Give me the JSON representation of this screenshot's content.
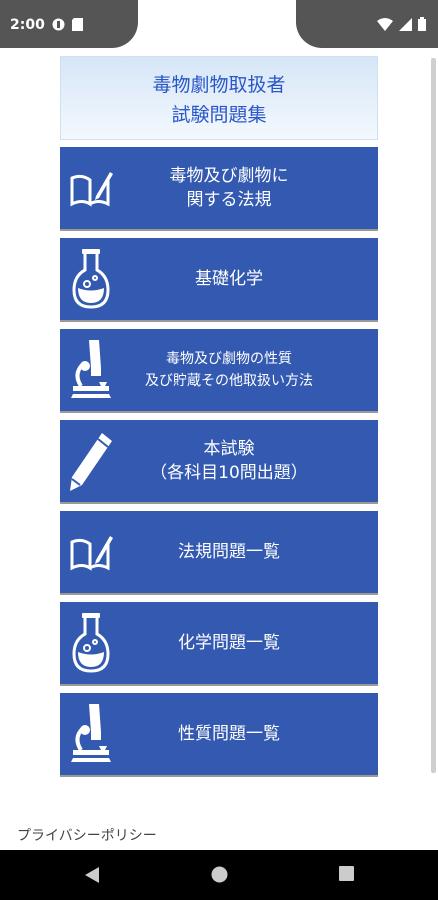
{
  "status_bar": {
    "time": "2:00"
  },
  "header": {
    "title_line1": "毒物劇物取扱者",
    "title_line2": "試験問題集"
  },
  "menu": [
    {
      "icon": "book-icon",
      "line1": "毒物及び劇物に",
      "line2": "関する法規"
    },
    {
      "icon": "flask-icon",
      "line1": "基礎化学",
      "line2": ""
    },
    {
      "icon": "microscope-icon",
      "line1": "毒物及び劇物の性質",
      "line2": "及び貯蔵その他取扱い方法"
    },
    {
      "icon": "pencil-icon",
      "line1": "本試験",
      "line2": "（各科目10問出題）"
    },
    {
      "icon": "book-icon",
      "line1": "法規問題一覧",
      "line2": ""
    },
    {
      "icon": "flask-icon",
      "line1": "化学問題一覧",
      "line2": ""
    },
    {
      "icon": "microscope-icon",
      "line1": "性質問題一覧",
      "line2": ""
    }
  ],
  "footer": {
    "privacy_link": "プライバシーポリシー"
  }
}
